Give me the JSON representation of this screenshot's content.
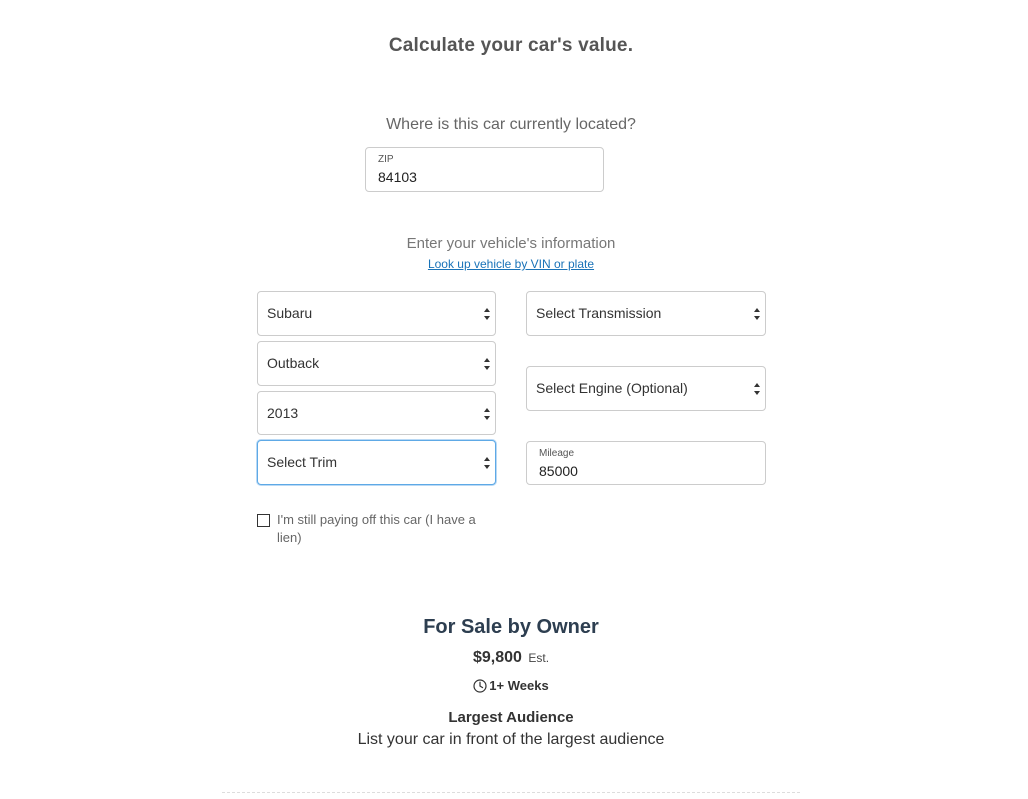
{
  "header": {
    "title": "Calculate your car's value."
  },
  "location": {
    "question": "Where is this car currently located?",
    "zip_label": "ZIP",
    "zip_value": "84103"
  },
  "vehicle": {
    "heading": "Enter your vehicle's information",
    "lookup_link": "Look up vehicle by VIN or plate",
    "make": "Subaru",
    "model": "Outback",
    "year": "2013",
    "trim": "Select Trim",
    "transmission": "Select Transmission",
    "engine": "Select Engine (Optional)",
    "mileage_label": "Mileage",
    "mileage_value": "85000",
    "lien_label": "I'm still paying off this car (I have a lien)"
  },
  "result": {
    "title": "For Sale by Owner",
    "price": "$9,800",
    "price_suffix": "Est.",
    "time_icon": "clock-icon",
    "time": "1+ Weeks",
    "audience_title": "Largest Audience",
    "audience_desc": "List your car in front of the largest audience"
  },
  "colors": {
    "link": "#1a73b8",
    "focus_border": "#5ea9e6",
    "result_title": "#2d3e50"
  }
}
